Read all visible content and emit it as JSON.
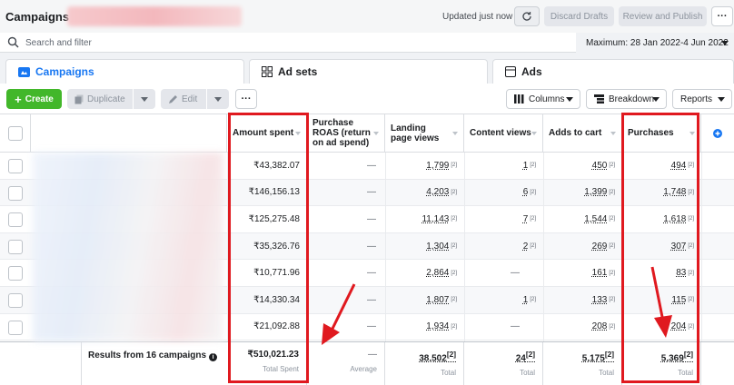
{
  "header": {
    "title": "Campaigns",
    "updated_text": "Updated just now",
    "discard_label": "Discard Drafts",
    "review_label": "Review and Publish",
    "more_label": "···"
  },
  "search": {
    "placeholder": "Search and filter",
    "date_range": "Maximum: 28 Jan 2022-4 Jun 2022"
  },
  "tabs": [
    {
      "label": "Campaigns",
      "icon": "folder-icon"
    },
    {
      "label": "Ad sets",
      "icon": "grid-icon"
    },
    {
      "label": "Ads",
      "icon": "ad-icon"
    }
  ],
  "toolbar": {
    "create_label": "Create",
    "duplicate_label": "Duplicate",
    "edit_label": "Edit",
    "more_label": "···",
    "columns_label": "Columns",
    "breakdown_label": "Breakdown",
    "reports_label": "Reports"
  },
  "table": {
    "columns": [
      "Amount spent",
      "Purchase ROAS (return on ad spend)",
      "Landing page views",
      "Content views",
      "Adds to cart",
      "Purchases"
    ],
    "rows": [
      {
        "amount": "₹43,382.07",
        "roas": "—",
        "lpv": "1,799",
        "cv": "1",
        "atc": "450",
        "purchases": "494"
      },
      {
        "amount": "₹146,156.13",
        "roas": "—",
        "lpv": "4,203",
        "cv": "6",
        "atc": "1,399",
        "purchases": "1,748"
      },
      {
        "amount": "₹125,275.48",
        "roas": "—",
        "lpv": "11,143",
        "cv": "7",
        "atc": "1,544",
        "purchases": "1,618"
      },
      {
        "amount": "₹35,326.76",
        "roas": "—",
        "lpv": "1,304",
        "cv": "2",
        "atc": "269",
        "purchases": "307"
      },
      {
        "amount": "₹10,771.96",
        "roas": "—",
        "lpv": "2,864",
        "cv": "—",
        "atc": "161",
        "purchases": "83"
      },
      {
        "amount": "₹14,330.34",
        "roas": "—",
        "lpv": "1,807",
        "cv": "1",
        "atc": "133",
        "purchases": "115"
      },
      {
        "amount": "₹21,092.88",
        "roas": "—",
        "lpv": "1,934",
        "cv": "—",
        "atc": "208",
        "purchases": "204"
      }
    ],
    "footer": {
      "label": "Results from 16 campaigns",
      "amount": "₹510,021.23",
      "amount_sub": "Total Spent",
      "roas": "—",
      "roas_sub": "Average",
      "lpv": "38,502",
      "lpv_sub": "Total",
      "cv": "24",
      "cv_sub": "Total",
      "atc": "5,175",
      "atc_sub": "Total",
      "purchases": "5,369",
      "purchases_sub": "Total"
    },
    "ref_mark": "[2]"
  },
  "colors": {
    "accent": "#1877f2",
    "create": "#42b72a",
    "highlight": "#e0191f"
  }
}
